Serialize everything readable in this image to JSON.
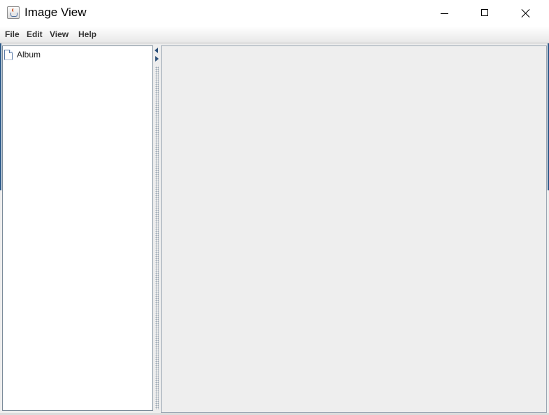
{
  "window": {
    "title": "Image View",
    "icon": "java-cup-icon"
  },
  "titlebar_buttons": {
    "minimize": "minimize-icon",
    "maximize": "maximize-icon",
    "close": "close-icon"
  },
  "menubar": {
    "items": [
      {
        "label": "File"
      },
      {
        "label": "Edit"
      },
      {
        "label": "View"
      },
      {
        "label": "Help"
      }
    ]
  },
  "tree": {
    "nodes": [
      {
        "label": "Album",
        "icon": "document-icon"
      }
    ]
  },
  "splitter": {
    "collapse_left_icon": "arrow-left-icon",
    "collapse_right_icon": "arrow-right-icon"
  },
  "colors": {
    "accent": "#2b5a8a",
    "panel_background": "#eeeeee",
    "tree_background": "#ffffff"
  }
}
